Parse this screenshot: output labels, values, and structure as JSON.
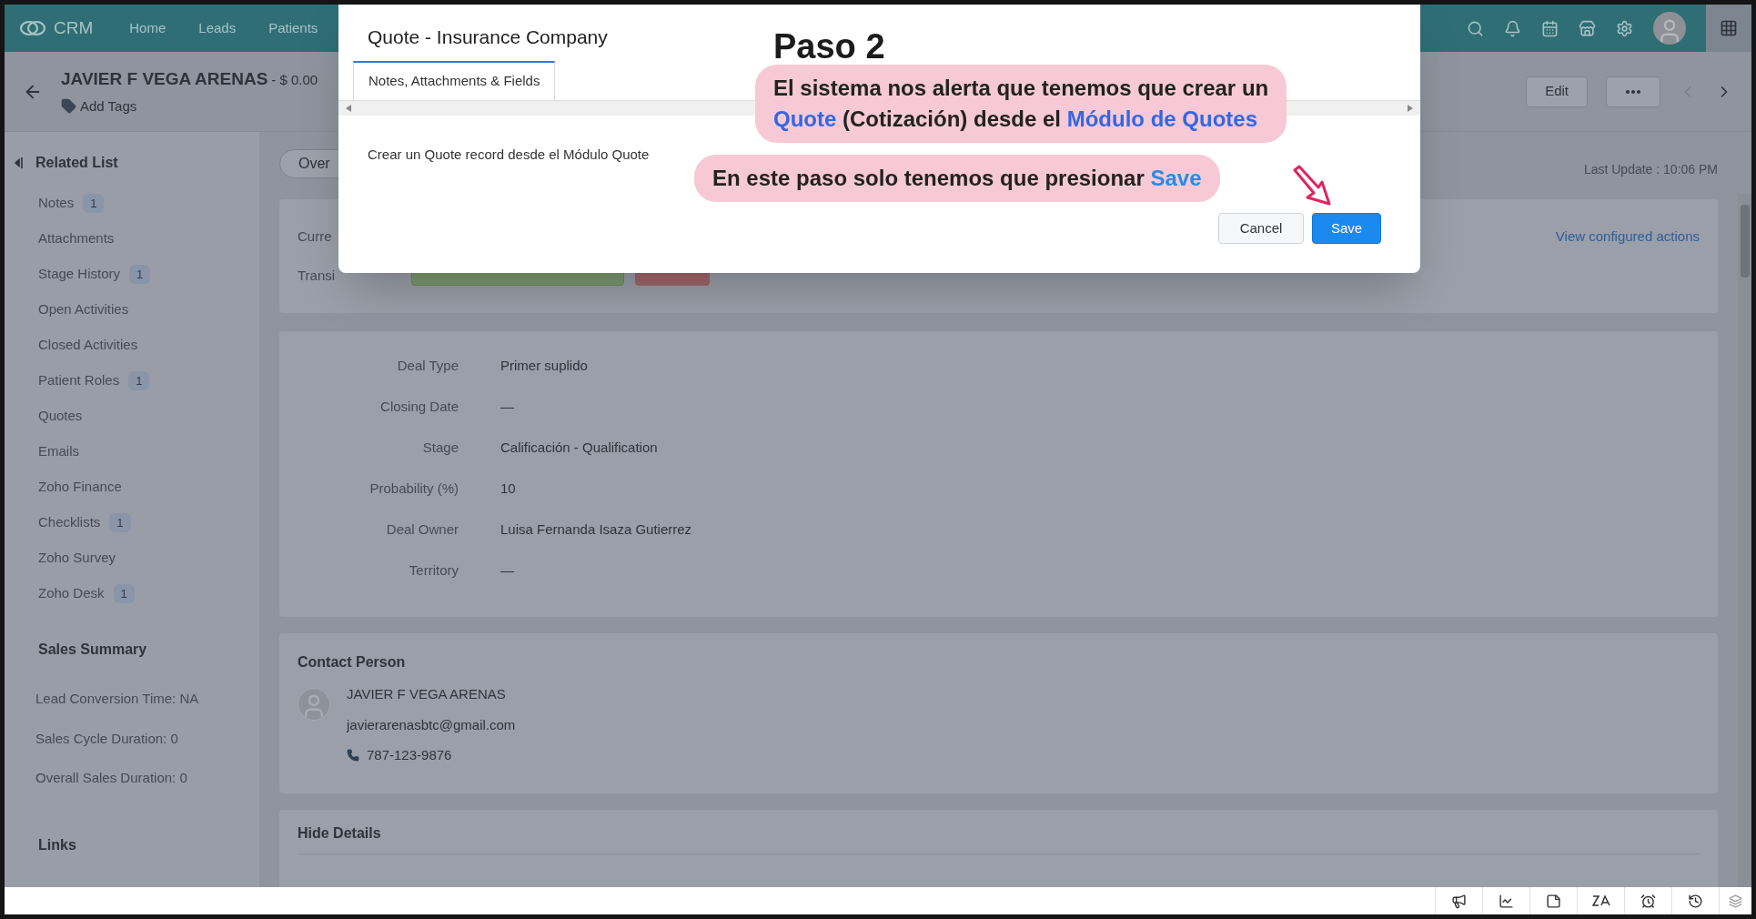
{
  "nav": {
    "app_name": "CRM",
    "tabs": [
      {
        "label": "Home",
        "selected": false
      },
      {
        "label": "Leads",
        "selected": false
      },
      {
        "label": "Patients",
        "selected": false
      }
    ]
  },
  "record": {
    "name": "JAVIER F VEGA ARENAS",
    "amount": "- $ 0.00",
    "add_tags": "Add Tags",
    "edit": "Edit"
  },
  "related_list": {
    "title": "Related List",
    "items": [
      {
        "label": "Notes",
        "count": "1"
      },
      {
        "label": "Attachments"
      },
      {
        "label": "Stage History",
        "count": "1"
      },
      {
        "label": "Open Activities"
      },
      {
        "label": "Closed Activities"
      },
      {
        "label": "Patient Roles",
        "count": "1"
      },
      {
        "label": "Quotes"
      },
      {
        "label": "Emails"
      },
      {
        "label": "Zoho Finance"
      },
      {
        "label": "Checklists",
        "count": "1"
      },
      {
        "label": "Zoho Survey"
      },
      {
        "label": "Zoho Desk",
        "count": "1"
      }
    ]
  },
  "sales_summary": {
    "title": "Sales Summary",
    "items": [
      "Lead Conversion Time: NA",
      "Sales Cycle Duration: 0",
      "Overall Sales Duration: 0"
    ]
  },
  "links": {
    "title": "Links"
  },
  "overview_tab": "Over",
  "last_update": "Last Update : 10:06 PM",
  "stage_card": {
    "labels": [
      "Curre",
      "Transi"
    ],
    "view_actions": "View configured actions"
  },
  "details": [
    {
      "label": "Deal Type",
      "value": "Primer suplido"
    },
    {
      "label": "Closing Date",
      "value": "—"
    },
    {
      "label": "Stage",
      "value": "Calificación - Qualification"
    },
    {
      "label": "Probability (%)",
      "value": "10"
    },
    {
      "label": "Deal Owner",
      "value": "Luisa Fernanda Isaza Gutierrez"
    },
    {
      "label": "Territory",
      "value": "—"
    }
  ],
  "contact": {
    "title": "Contact Person",
    "name": "JAVIER F VEGA ARENAS",
    "email": "javierarenasbtc@gmail.com",
    "phone": "787-123-9876"
  },
  "hide_details": "Hide Details",
  "modal": {
    "title": "Quote - Insurance Company",
    "tabs": [
      {
        "label": "Notes, Attachments & Fields",
        "selected": true
      }
    ],
    "message": "Crear un Quote record desde el Módulo Quote",
    "buttons": [
      {
        "label": "Cancel",
        "kind": "secondary"
      },
      {
        "label": "Save",
        "kind": "primary"
      }
    ]
  },
  "annotation": {
    "step": "Paso 2",
    "bubbles": [
      [
        [
          {
            "text": "El sistema nos alerta que tenemos que crear un",
            "highlight": false
          }
        ],
        [
          {
            "text": "Quote",
            "highlight": true
          },
          {
            "text": " (Cotización) desde el ",
            "highlight": false
          },
          {
            "text": "Módulo de Quotes",
            "highlight": true
          }
        ]
      ],
      [
        [
          {
            "text": "En este paso solo tenemos que presionar ",
            "highlight": false
          },
          {
            "text": "Save",
            "highlight": true
          }
        ]
      ]
    ]
  }
}
